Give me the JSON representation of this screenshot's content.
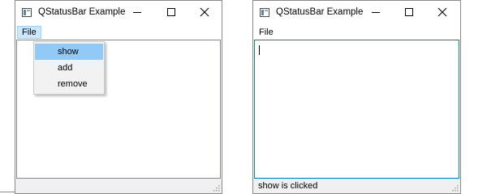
{
  "left_window": {
    "title": "QStatusBar Example",
    "menu": {
      "file_label": "File"
    },
    "dropdown_items": [
      {
        "label": "show",
        "highlighted": true
      },
      {
        "label": "add",
        "highlighted": false
      },
      {
        "label": "remove",
        "highlighted": false
      }
    ],
    "status_text": ""
  },
  "right_window": {
    "title": "QStatusBar Example",
    "menu": {
      "file_label": "File"
    },
    "status_text": "show is clicked"
  },
  "colors": {
    "menu_highlight": "#91c9f7",
    "menu_active": "#cce8ff",
    "focus_border": "#0078d7",
    "statusbar": "#f0f0f0"
  },
  "icons": [
    "app-icon",
    "minimize-icon",
    "maximize-icon",
    "close-icon",
    "size-grip-icon"
  ]
}
